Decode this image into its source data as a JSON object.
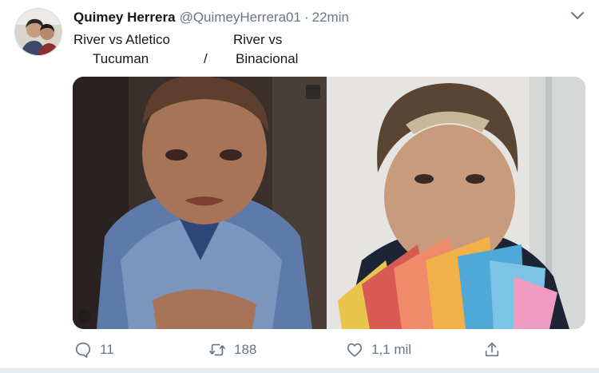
{
  "tweet": {
    "author": {
      "display_name": "Quimey Herrera",
      "handle": "@QuimeyHerrera01",
      "separator": "·",
      "time": "22min"
    },
    "text": {
      "left_line1": "River vs Atletico",
      "left_line2": "Tucuman",
      "slash": "/",
      "right_line1": "River vs",
      "right_line2": "Binacional"
    },
    "actions": {
      "reply_count": "11",
      "retweet_count": "188",
      "like_count": "1,1 mil"
    }
  },
  "icons": {
    "menu": "chevron-down-icon",
    "reply": "reply-icon",
    "retweet": "retweet-icon",
    "like": "heart-icon",
    "share": "share-icon"
  },
  "colors": {
    "text": "#14171a",
    "secondary": "#657786",
    "separator": "#e6ecf0"
  }
}
